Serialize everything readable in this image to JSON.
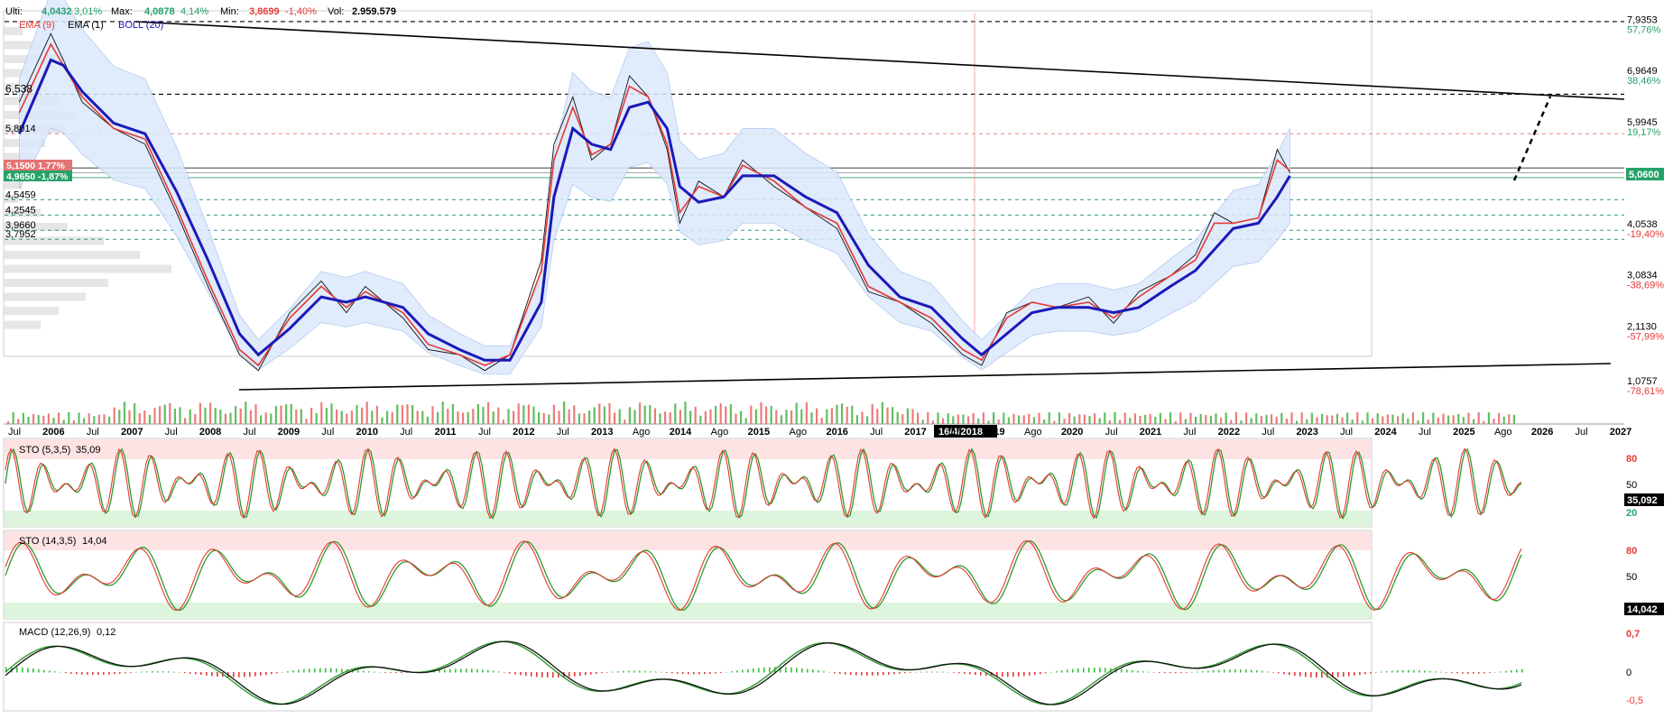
{
  "header": {
    "items": [
      {
        "label": "Ulti:",
        "value": "4,0432",
        "pct": "3,01%",
        "color": "#26a269"
      },
      {
        "label": "Max:",
        "value": "4,0878",
        "pct": "4,14%",
        "color": "#26a269"
      },
      {
        "label": "Min:",
        "value": "3,8699",
        "pct": "-1,40%",
        "color": "#e53935"
      },
      {
        "label": "Vol:",
        "value": "2.959.579",
        "pct": "",
        "color": "#000000"
      }
    ],
    "indicators": [
      {
        "label": "EMA (9)",
        "color": "#e53935"
      },
      {
        "label": "EMA (1)",
        "color": "#000000"
      },
      {
        "label": "BOLL (20)",
        "color": "#1a1ab8"
      }
    ]
  },
  "price_panel": {
    "right_axis": [
      {
        "price": "7,9353",
        "pct": "57,76%",
        "pct_color": "#26a269"
      },
      {
        "price": "6,9649",
        "pct": "38,46%",
        "pct_color": "#26a269"
      },
      {
        "price": "5,9945",
        "pct": "19,17%",
        "pct_color": "#26a269"
      },
      {
        "price": "4,0538",
        "pct": "-19,40%",
        "pct_color": "#e53935"
      },
      {
        "price": "3,0834",
        "pct": "-38,69%",
        "pct_color": "#e53935"
      },
      {
        "price": "2,1130",
        "pct": "-57,99%",
        "pct_color": "#e53935"
      },
      {
        "price": "1,0757",
        "pct": "-78,61%",
        "pct_color": "#e53935"
      }
    ],
    "current_price": "5,0600",
    "left_levels": [
      "6,538",
      "5,8014",
      "4,5459",
      "4,2545",
      "3,9660",
      "3,7952"
    ],
    "tags": [
      {
        "text": "5,1500  1,77%",
        "color": "#e57373"
      },
      {
        "text": "4,9650  -1,87%",
        "color": "#26a269"
      }
    ],
    "crosshair_date": "16/4/2018",
    "x_labels": [
      "Jul",
      "2006",
      "Jul",
      "2007",
      "Jul",
      "2008",
      "Jul",
      "2009",
      "Jul",
      "2010",
      "Jul",
      "2011",
      "Jul",
      "2012",
      "Jul",
      "2013",
      "Ago",
      "2014",
      "Ago",
      "2015",
      "Ago",
      "2016",
      "Jul",
      "2017",
      "Jul",
      "2019",
      "Ago",
      "2020",
      "Jul",
      "2021",
      "Jul",
      "2022",
      "Jul",
      "2023",
      "Jul",
      "2024",
      "Jul",
      "2025",
      "Ago",
      "2026",
      "Jul",
      "2027"
    ]
  },
  "sto1": {
    "label": "STO (5,3,5)",
    "value": "35,09",
    "tag": "35,092",
    "axis": [
      "80",
      "50",
      "20"
    ]
  },
  "sto2": {
    "label": "STO (14,3,5)",
    "value": "14,04",
    "tag": "14,042",
    "axis": [
      "80",
      "50"
    ]
  },
  "macd": {
    "label": "MACD (12,26,9)",
    "value": "0,12",
    "axis": [
      "0,7",
      "0",
      "-0,5"
    ]
  },
  "colors": {
    "up": "#26a269",
    "down": "#e53935",
    "boll": "#1a1ab8",
    "band": "#dbe8fb"
  },
  "chart_data": {
    "type": "line",
    "title": "",
    "x": [
      2005.5,
      2006.0,
      2006.2,
      2006.5,
      2007.0,
      2007.5,
      2008.0,
      2008.5,
      2009.0,
      2009.3,
      2009.8,
      2010.3,
      2010.7,
      2011.0,
      2011.6,
      2012.0,
      2012.5,
      2012.9,
      2013.3,
      2013.8,
      2014.0,
      2014.3,
      2014.6,
      2014.9,
      2015.2,
      2015.5,
      2015.8,
      2016.0,
      2016.3,
      2016.7,
      2017.0,
      2017.5,
      2018.0,
      2018.5,
      2019.0,
      2019.5,
      2020.0,
      2020.5,
      2020.8,
      2021.2,
      2021.6,
      2022.0,
      2022.5,
      2022.9,
      2023.3,
      2023.8,
      2024.2,
      2024.5,
      2024.8,
      2025.2,
      2025.5,
      2025.7
    ],
    "series": [
      {
        "name": "EMA (1)",
        "values": [
          6.4,
          7.7,
          7.2,
          6.4,
          5.9,
          5.6,
          4.3,
          2.9,
          1.6,
          1.3,
          2.4,
          3.0,
          2.4,
          2.9,
          2.3,
          1.7,
          1.6,
          1.3,
          1.6,
          3.4,
          5.6,
          6.5,
          5.3,
          5.6,
          6.9,
          6.5,
          5.5,
          4.1,
          4.9,
          4.6,
          5.3,
          4.8,
          4.4,
          4.0,
          2.8,
          2.6,
          2.2,
          1.6,
          1.4,
          2.4,
          2.6,
          2.5,
          2.7,
          2.2,
          2.8,
          3.1,
          3.5,
          4.3,
          4.1,
          4.2,
          5.5,
          5.06
        ]
      },
      {
        "name": "EMA (9)",
        "values": [
          6.2,
          7.5,
          7.1,
          6.5,
          5.9,
          5.7,
          4.4,
          3.0,
          1.7,
          1.4,
          2.3,
          2.9,
          2.5,
          2.8,
          2.4,
          1.8,
          1.6,
          1.4,
          1.6,
          3.2,
          5.3,
          6.3,
          5.4,
          5.6,
          6.7,
          6.5,
          5.6,
          4.3,
          4.8,
          4.6,
          5.2,
          4.9,
          4.4,
          4.1,
          2.9,
          2.6,
          2.3,
          1.7,
          1.5,
          2.3,
          2.6,
          2.5,
          2.6,
          2.3,
          2.7,
          3.1,
          3.4,
          4.1,
          4.1,
          4.2,
          5.3,
          5.1
        ]
      },
      {
        "name": "BOLL (20)",
        "values": [
          5.8,
          7.2,
          7.1,
          6.6,
          6.0,
          5.8,
          4.7,
          3.4,
          2.0,
          1.6,
          2.1,
          2.7,
          2.6,
          2.7,
          2.5,
          2.0,
          1.7,
          1.5,
          1.5,
          2.6,
          4.6,
          5.9,
          5.6,
          5.5,
          6.3,
          6.4,
          5.9,
          4.8,
          4.5,
          4.6,
          5.0,
          5.0,
          4.6,
          4.3,
          3.3,
          2.7,
          2.5,
          1.9,
          1.6,
          2.0,
          2.4,
          2.5,
          2.5,
          2.4,
          2.5,
          2.9,
          3.2,
          3.6,
          4.0,
          4.1,
          4.6,
          5.0
        ]
      }
    ],
    "ylim": [
      0.8,
      8.1
    ]
  }
}
